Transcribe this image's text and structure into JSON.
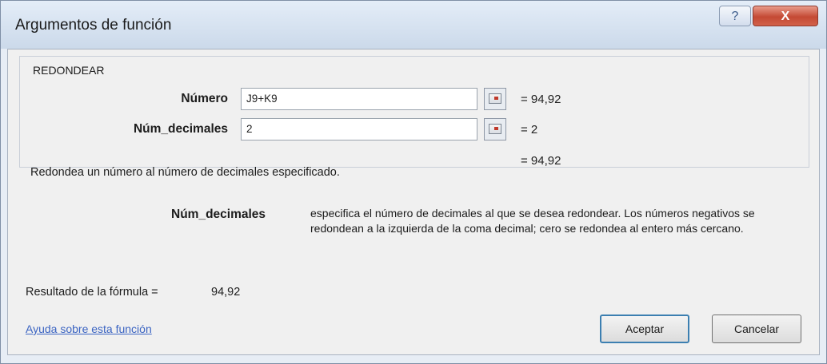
{
  "window": {
    "title": "Argumentos de función",
    "help_label": "?",
    "close_label": "X"
  },
  "function": {
    "name": "REDONDEAR",
    "args": [
      {
        "label": "Número",
        "value": "J9+K9",
        "result": "= 94,92"
      },
      {
        "label": "Núm_decimales",
        "value": "2",
        "result": "= 2"
      }
    ],
    "overall_result": "= 94,92",
    "description": "Redondea un número al número de decimales especificado.",
    "arg_help_label": "Núm_decimales",
    "arg_help_text": "especifica el número de decimales al que se desea redondear. Los números negativos se redondean a la izquierda de la coma decimal; cero se redondea al entero más cercano."
  },
  "footer": {
    "result_label": "Resultado de la fórmula =",
    "result_value": "94,92",
    "help_link": "Ayuda sobre esta función",
    "ok_label": "Aceptar",
    "cancel_label": "Cancelar"
  }
}
